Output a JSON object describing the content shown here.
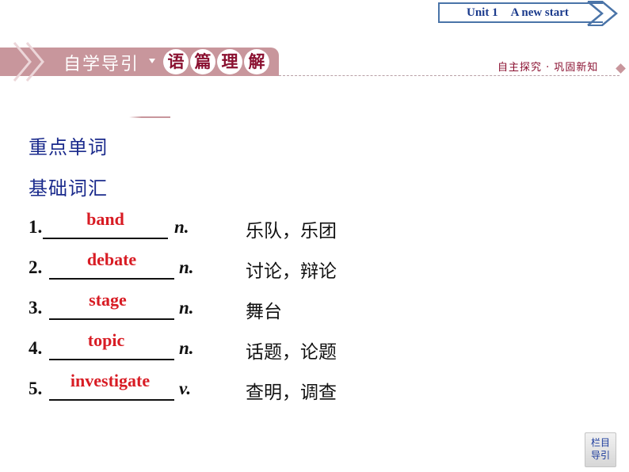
{
  "unit_tab": {
    "unit_num": "Unit 1",
    "unit_title": "A new start"
  },
  "header": {
    "section_title": "自学导引",
    "circle_chars": [
      "语",
      "篇",
      "理",
      "解"
    ],
    "right_caption": "自主探究 · 巩固新知"
  },
  "content": {
    "heading1": "重点单词",
    "heading2": "基础词汇",
    "vocab": [
      {
        "num": "1.",
        "answer": "band",
        "pos": "n.",
        "meaning": "乐队，乐团"
      },
      {
        "num": "2.",
        "answer": "debate",
        "pos": "n.",
        "meaning": "讨论，辩论"
      },
      {
        "num": "3.",
        "answer": "stage",
        "pos": "n.",
        "meaning": "舞台"
      },
      {
        "num": "4.",
        "answer": "topic",
        "pos": "n.",
        "meaning": "话题，论题"
      },
      {
        "num": "5.",
        "answer": "investigate",
        "pos": "v.",
        "meaning": "查明，调查"
      }
    ]
  },
  "nav_button": {
    "line1": "栏目",
    "line2": "导引"
  },
  "colors": {
    "accent_pink": "#c8969c",
    "accent_crimson": "#8a1030",
    "answer_red": "#d81c24",
    "heading_blue": "#1a2a8c",
    "unit_blue": "#1a3a8c"
  }
}
